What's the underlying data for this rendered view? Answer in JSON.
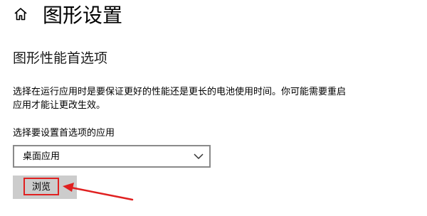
{
  "header": {
    "home_icon": "home-icon",
    "title": "图形设置"
  },
  "section": {
    "title": "图形性能首选项",
    "description": "选择在运行应用时是要保证更好的性能还是更长的电池使用时间。你可能需要重启应用才能让更改生效。"
  },
  "app_select": {
    "label": "选择要设置首选项的应用",
    "value": "桌面应用",
    "chevron_icon": "chevron-down-icon"
  },
  "browse": {
    "label": "浏览"
  },
  "annotation": {
    "color": "#e02020"
  }
}
